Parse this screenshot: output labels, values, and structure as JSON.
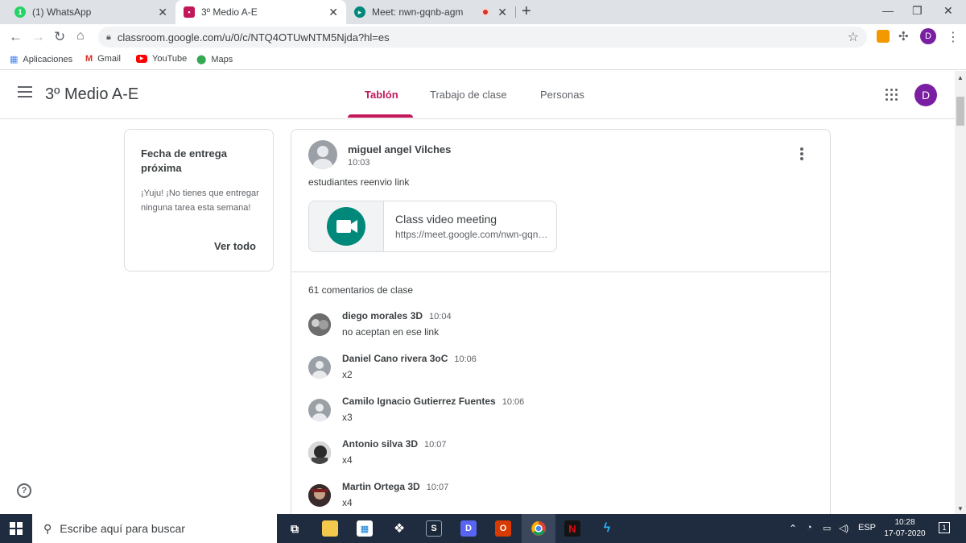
{
  "browser": {
    "tabs": [
      {
        "title": "(1) WhatsApp",
        "favicon_color": "#25d366"
      },
      {
        "title": "3º Medio A-E",
        "favicon_color": "#c2185b"
      },
      {
        "title": "Meet: nwn-gqnb-agm",
        "favicon_color": "#00897b"
      }
    ],
    "url": "classroom.google.com/u/0/c/NTQ4OTUwNTM5Njda?hl=es",
    "profile_initial": "D"
  },
  "bookmarks": [
    {
      "label": "Aplicaciones",
      "icon": "apps-grid-icon"
    },
    {
      "label": "Gmail",
      "icon": "gmail-icon"
    },
    {
      "label": "YouTube",
      "icon": "youtube-icon"
    },
    {
      "label": "Maps",
      "icon": "maps-icon"
    }
  ],
  "classroom": {
    "class_title": "3º Medio A-E",
    "tabs": [
      "Tablón",
      "Trabajo de clase",
      "Personas"
    ],
    "active_tab": "Tablón",
    "user_initial": "D",
    "accent_color": "#c2185b"
  },
  "due_card": {
    "title": "Fecha de entrega próxima",
    "text": "¡Yuju! ¡No tienes que entregar ninguna tarea esta semana!",
    "link": "Ver todo"
  },
  "post": {
    "author": "miguel angel Vilches",
    "time": "10:03",
    "text": "estudiantes reenvio link",
    "attachment": {
      "title": "Class video meeting",
      "url": "https://meet.google.com/nwn-gqnb-agm"
    },
    "comments_count": "61 comentarios de clase",
    "comments": [
      {
        "name": "diego morales 3D",
        "time": "10:04",
        "text": "no aceptan en ese link"
      },
      {
        "name": "Daniel Cano rivera 3oC",
        "time": "10:06",
        "text": "x2"
      },
      {
        "name": "Camilo Ignacio Gutierrez Fuentes",
        "time": "10:06",
        "text": "x3"
      },
      {
        "name": "Antonio silva 3D",
        "time": "10:07",
        "text": "x4"
      },
      {
        "name": "Martin Ortega 3D",
        "time": "10:07",
        "text": "x4"
      }
    ]
  },
  "taskbar": {
    "search_placeholder": "Escribe aquí para buscar",
    "language": "ESP",
    "time": "10:28",
    "date": "17-07-2020",
    "notification_count": "1"
  }
}
